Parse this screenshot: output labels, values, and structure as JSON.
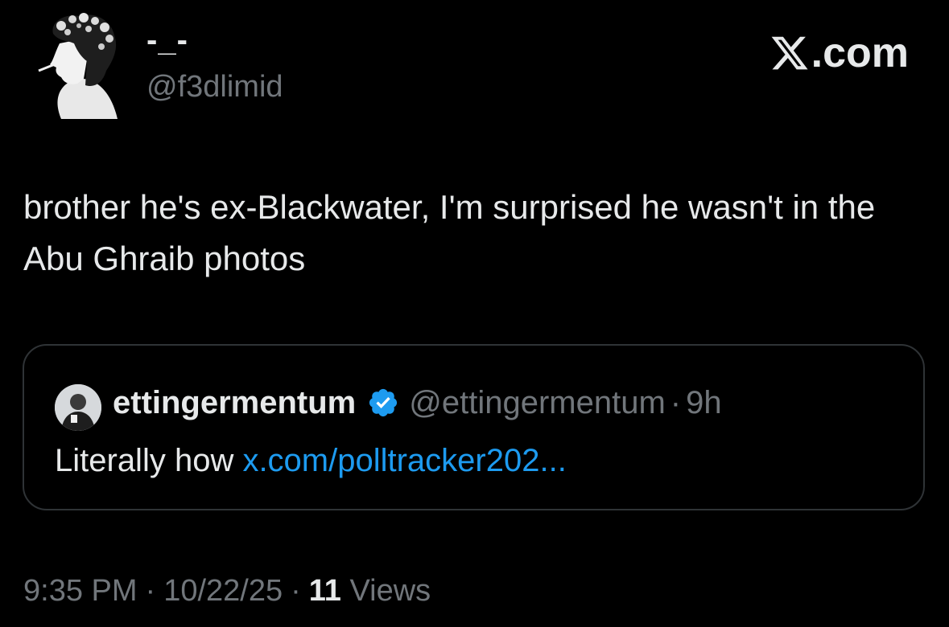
{
  "author": {
    "display_name": "-_-",
    "handle": "@f3dlimid",
    "avatar_icon": "silhouette-avatar-icon"
  },
  "brand": {
    "label": ".com",
    "logo_icon": "x-logo-icon"
  },
  "tweet": {
    "text": "brother he's ex-Blackwater, I'm surprised he wasn't in the Abu Ghraib photos"
  },
  "quoted_tweet": {
    "display_name": "ettingermentum",
    "handle": "@ettingermentum",
    "separator": "·",
    "time": "9h",
    "verified_icon": "verified-badge-icon",
    "verified_color": "#1d9bf0",
    "body_text": "Literally how ",
    "link_text": "x.com/polltracker202..."
  },
  "meta": {
    "time": "9:35 PM",
    "separator": "·",
    "date": "10/22/25",
    "views_count": "11",
    "views_label": "Views"
  },
  "colors": {
    "background": "#000000",
    "primary_text": "#e7e9ea",
    "secondary_text": "#71767b",
    "link": "#1d9bf0",
    "border": "#2f3336"
  }
}
